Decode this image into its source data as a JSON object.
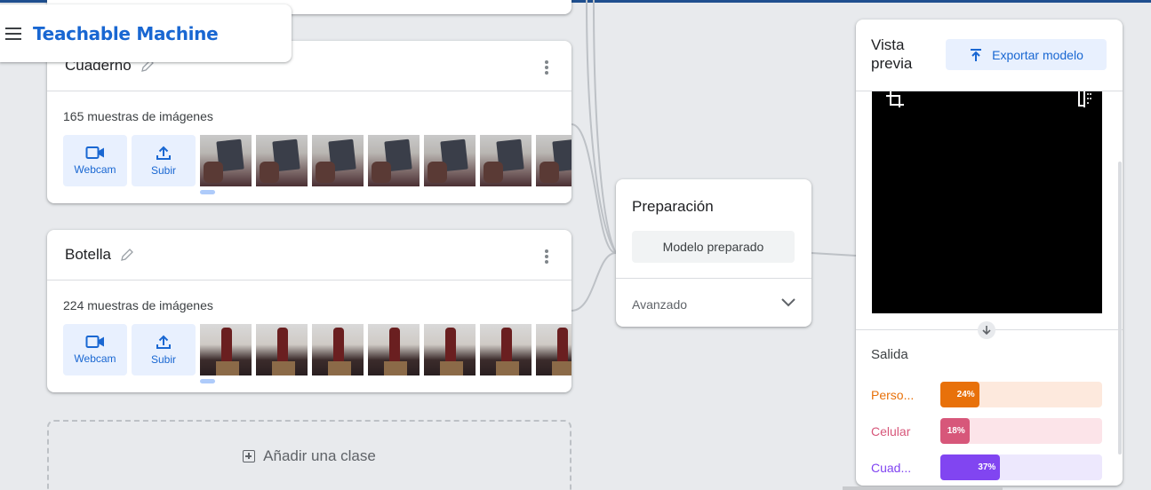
{
  "app": {
    "title": "Teachable Machine"
  },
  "classes": [
    {
      "name": "Cuaderno",
      "samples_label": "165 muestras de imágenes",
      "webcam_label": "Webcam",
      "upload_label": "Subir",
      "thumb_kind": "notebook"
    },
    {
      "name": "Botella",
      "samples_label": "224 muestras de imágenes",
      "webcam_label": "Webcam",
      "upload_label": "Subir",
      "thumb_kind": "bottle"
    }
  ],
  "add_class_label": "Añadir una clase",
  "training": {
    "title": "Preparación",
    "button_label": "Modelo preparado",
    "advanced_label": "Avanzado"
  },
  "preview": {
    "title": "Vista previa",
    "export_label": "Exportar modelo",
    "output_title": "Salida",
    "outputs": [
      {
        "label": "Perso...",
        "percent_label": "24%",
        "value": 24,
        "color": "#e8710a",
        "track": "#fde9dd"
      },
      {
        "label": "Celular",
        "percent_label": "18%",
        "value": 18,
        "color": "#d7577a",
        "track": "#fce4e9"
      },
      {
        "label": "Cuad...",
        "percent_label": "37%",
        "value": 37,
        "color": "#8145f1",
        "track": "#ede8fd"
      }
    ]
  },
  "icons": {
    "menu": "menu-icon",
    "edit": "pencil-icon",
    "more": "more-vert-icon",
    "webcam": "videocam-icon",
    "upload": "upload-icon",
    "add": "add-box-icon",
    "expand": "chevron-down-icon",
    "export": "upload-icon",
    "crop": "crop-icon",
    "flip": "flip-icon",
    "arrow_down": "arrow-down-icon"
  }
}
